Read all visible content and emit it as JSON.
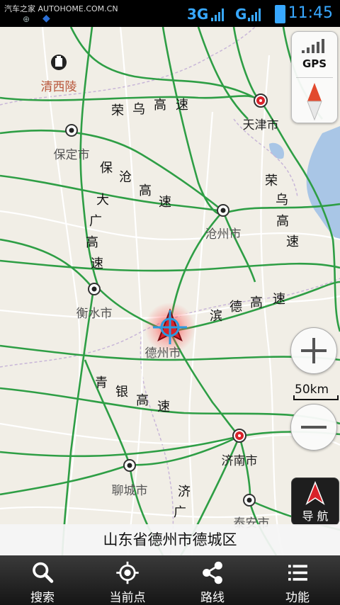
{
  "status_bar": {
    "watermark": "汽车之家  AUTOHOME.COM.CN",
    "network_3g": "3G",
    "network_g": "G",
    "time": "11:45"
  },
  "map": {
    "cities": [
      "清西陵",
      "保定市",
      "天津市",
      "沧州市",
      "衡水市",
      "德州市",
      "济南市",
      "聊城市",
      "泰安市"
    ],
    "roads": {
      "rongwu": [
        "荣",
        "乌",
        "高",
        "速"
      ],
      "baocang": [
        "保",
        "沧",
        "高",
        "速"
      ],
      "daguang": [
        "大",
        "广",
        "高",
        "速"
      ],
      "rongwu_right": [
        "荣",
        "乌",
        "高",
        "速"
      ],
      "binde": [
        "滨",
        "德",
        "高",
        "速"
      ],
      "qingyin": [
        "青",
        "银",
        "高",
        "速"
      ],
      "jiguang": [
        "济",
        "广"
      ]
    },
    "scale": "50km",
    "gps_label": "GPS",
    "navigate_label": "导 航"
  },
  "address": "山东省德州市德城区",
  "bottom_nav": [
    {
      "label": "搜索",
      "icon": "search-icon"
    },
    {
      "label": "当前点",
      "icon": "locate-icon"
    },
    {
      "label": "路线",
      "icon": "share-route-icon"
    },
    {
      "label": "功能",
      "icon": "menu-icon"
    }
  ],
  "colors": {
    "highway": "#2e9e45",
    "map_bg": "#f1eee6",
    "accent": "#38a8ff",
    "location": "#d8222a"
  }
}
